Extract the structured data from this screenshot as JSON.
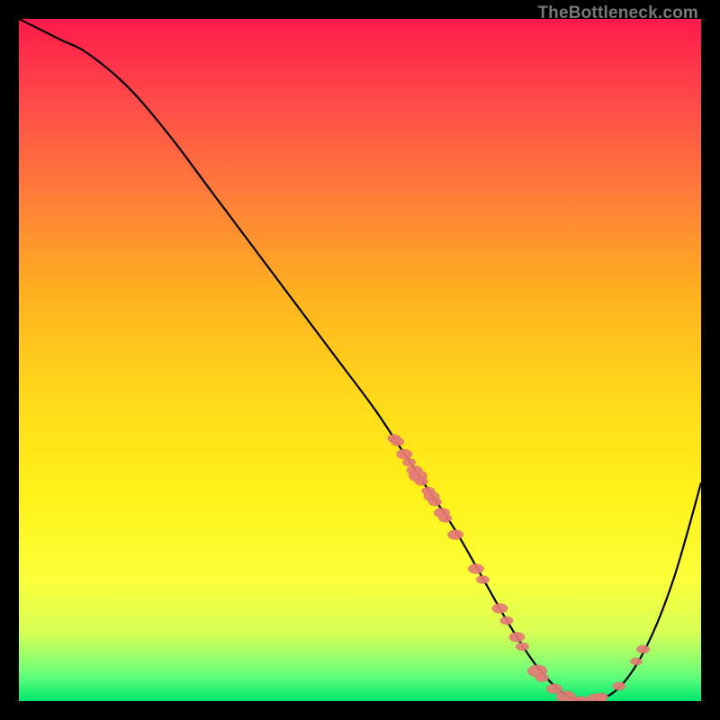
{
  "watermark": "TheBottleneck.com",
  "colors": {
    "page_bg": "#000000",
    "gradient": [
      "#ff1a4a",
      "#ff4a4a",
      "#ff7a3a",
      "#ffb020",
      "#ffd81a",
      "#fff21a",
      "#fcff3a",
      "#d8ff55",
      "#6aff7a",
      "#00e870"
    ],
    "curve_stroke": "#000000",
    "marker_fill": "#e57b77",
    "marker_stroke": "#c85a56"
  },
  "chart_data": {
    "type": "line",
    "title": "",
    "xlabel": "",
    "ylabel": "",
    "xlim": [
      0,
      100
    ],
    "ylim": [
      0,
      100
    ],
    "grid": false,
    "series": [
      {
        "name": "bottleneck-curve",
        "x": [
          0,
          6,
          10,
          16,
          22,
          28,
          34,
          40,
          46,
          52,
          56,
          60,
          64,
          68,
          72,
          76,
          80,
          84,
          88,
          92,
          96,
          100
        ],
        "y": [
          100,
          97,
          95,
          90,
          83,
          75,
          67,
          59,
          51,
          43,
          37,
          31,
          25,
          18,
          11,
          5,
          1,
          0,
          2,
          8,
          18,
          32
        ]
      }
    ],
    "markers": [
      {
        "x": 55.0,
        "y": 38.5,
        "r": 1.0
      },
      {
        "x": 55.5,
        "y": 38.0,
        "r": 1.0
      },
      {
        "x": 56.5,
        "y": 36.2,
        "r": 1.2
      },
      {
        "x": 57.2,
        "y": 35.0,
        "r": 1.0
      },
      {
        "x": 58.0,
        "y": 33.8,
        "r": 1.2
      },
      {
        "x": 58.5,
        "y": 33.0,
        "r": 1.4
      },
      {
        "x": 59.0,
        "y": 32.2,
        "r": 1.0
      },
      {
        "x": 60.0,
        "y": 30.8,
        "r": 1.0
      },
      {
        "x": 60.5,
        "y": 30.0,
        "r": 1.2
      },
      {
        "x": 61.0,
        "y": 29.2,
        "r": 1.0
      },
      {
        "x": 62.0,
        "y": 27.6,
        "r": 1.2
      },
      {
        "x": 62.5,
        "y": 26.8,
        "r": 1.0
      },
      {
        "x": 64.0,
        "y": 24.4,
        "r": 1.2
      },
      {
        "x": 67.0,
        "y": 19.4,
        "r": 1.2
      },
      {
        "x": 68.0,
        "y": 17.8,
        "r": 1.0
      },
      {
        "x": 70.5,
        "y": 13.6,
        "r": 1.2
      },
      {
        "x": 71.5,
        "y": 11.8,
        "r": 1.0
      },
      {
        "x": 73.0,
        "y": 9.4,
        "r": 1.2
      },
      {
        "x": 73.8,
        "y": 8.0,
        "r": 1.0
      },
      {
        "x": 76.0,
        "y": 4.4,
        "r": 1.5
      },
      {
        "x": 76.7,
        "y": 3.4,
        "r": 1.0
      },
      {
        "x": 78.5,
        "y": 1.8,
        "r": 1.2
      },
      {
        "x": 80.2,
        "y": 0.6,
        "r": 1.5
      },
      {
        "x": 82.4,
        "y": 0.0,
        "r": 1.2
      },
      {
        "x": 84.6,
        "y": 0.2,
        "r": 1.5
      },
      {
        "x": 85.4,
        "y": 0.6,
        "r": 1.0
      },
      {
        "x": 88.0,
        "y": 2.2,
        "r": 1.0
      },
      {
        "x": 90.5,
        "y": 5.8,
        "r": 0.9
      },
      {
        "x": 91.5,
        "y": 7.6,
        "r": 1.0
      }
    ]
  }
}
